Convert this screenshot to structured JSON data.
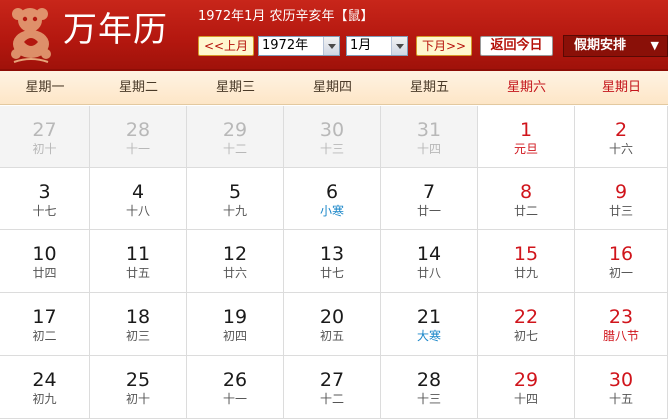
{
  "header": {
    "title": "万年历",
    "lunar_info": "1972年1月 农历辛亥年【鼠】",
    "prev_label": "<<上月",
    "year_value": "1972年",
    "month_value": "1月",
    "next_label": "下月>>",
    "today_label": "返回今日",
    "holiday_label": "假期安排",
    "holiday_arrow": "▼"
  },
  "weekdays": [
    "星期一",
    "星期二",
    "星期三",
    "星期四",
    "星期五",
    "星期六",
    "星期日"
  ],
  "weeks": [
    [
      {
        "day": "27",
        "lunar": "初十",
        "kind": "other"
      },
      {
        "day": "28",
        "lunar": "十一",
        "kind": "other"
      },
      {
        "day": "29",
        "lunar": "十二",
        "kind": "other"
      },
      {
        "day": "30",
        "lunar": "十三",
        "kind": "other"
      },
      {
        "day": "31",
        "lunar": "十四",
        "kind": "other"
      },
      {
        "day": "1",
        "lunar": "元旦",
        "kind": "weekend",
        "note": "festival"
      },
      {
        "day": "2",
        "lunar": "十六",
        "kind": "weekend"
      }
    ],
    [
      {
        "day": "3",
        "lunar": "十七"
      },
      {
        "day": "4",
        "lunar": "十八"
      },
      {
        "day": "5",
        "lunar": "十九"
      },
      {
        "day": "6",
        "lunar": "小寒",
        "note": "term"
      },
      {
        "day": "7",
        "lunar": "廿一"
      },
      {
        "day": "8",
        "lunar": "廿二",
        "kind": "weekend"
      },
      {
        "day": "9",
        "lunar": "廿三",
        "kind": "weekend"
      }
    ],
    [
      {
        "day": "10",
        "lunar": "廿四"
      },
      {
        "day": "11",
        "lunar": "廿五"
      },
      {
        "day": "12",
        "lunar": "廿六"
      },
      {
        "day": "13",
        "lunar": "廿七"
      },
      {
        "day": "14",
        "lunar": "廿八"
      },
      {
        "day": "15",
        "lunar": "廿九",
        "kind": "weekend"
      },
      {
        "day": "16",
        "lunar": "初一",
        "kind": "weekend"
      }
    ],
    [
      {
        "day": "17",
        "lunar": "初二"
      },
      {
        "day": "18",
        "lunar": "初三"
      },
      {
        "day": "19",
        "lunar": "初四"
      },
      {
        "day": "20",
        "lunar": "初五"
      },
      {
        "day": "21",
        "lunar": "大寒",
        "note": "term"
      },
      {
        "day": "22",
        "lunar": "初七",
        "kind": "weekend"
      },
      {
        "day": "23",
        "lunar": "腊八节",
        "kind": "weekend",
        "note": "festival"
      }
    ],
    [
      {
        "day": "24",
        "lunar": "初九"
      },
      {
        "day": "25",
        "lunar": "初十"
      },
      {
        "day": "26",
        "lunar": "十一"
      },
      {
        "day": "27",
        "lunar": "十二"
      },
      {
        "day": "28",
        "lunar": "十三"
      },
      {
        "day": "29",
        "lunar": "十四",
        "kind": "weekend"
      },
      {
        "day": "30",
        "lunar": "十五",
        "kind": "weekend"
      }
    ]
  ],
  "colors": {
    "header_red": "#b3170f",
    "weekend_red": "#d0141b",
    "solar_term_blue": "#1b87c9",
    "other_month_gray": "#b8b8b8"
  }
}
